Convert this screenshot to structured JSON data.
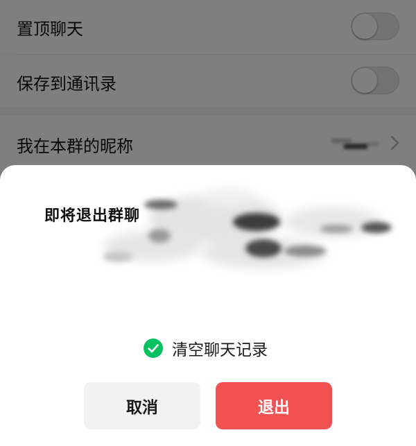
{
  "settings": {
    "rows": [
      {
        "label": "置顶聊天",
        "toggle_on": false
      },
      {
        "label": "保存到通讯录",
        "toggle_on": false
      },
      {
        "label": "我在本群的昵称"
      }
    ]
  },
  "dialog": {
    "title": "即将退出群聊",
    "clear_history_label": "清空聊天记录",
    "clear_history_checked": true,
    "cancel_label": "取消",
    "exit_label": "退出"
  },
  "colors": {
    "check_green": "#07c160",
    "exit_red": "#f05252",
    "cancel_gray": "#f2f2f2"
  },
  "icons": {
    "check": "check-circle-icon",
    "chevron": "chevron-right-icon"
  }
}
